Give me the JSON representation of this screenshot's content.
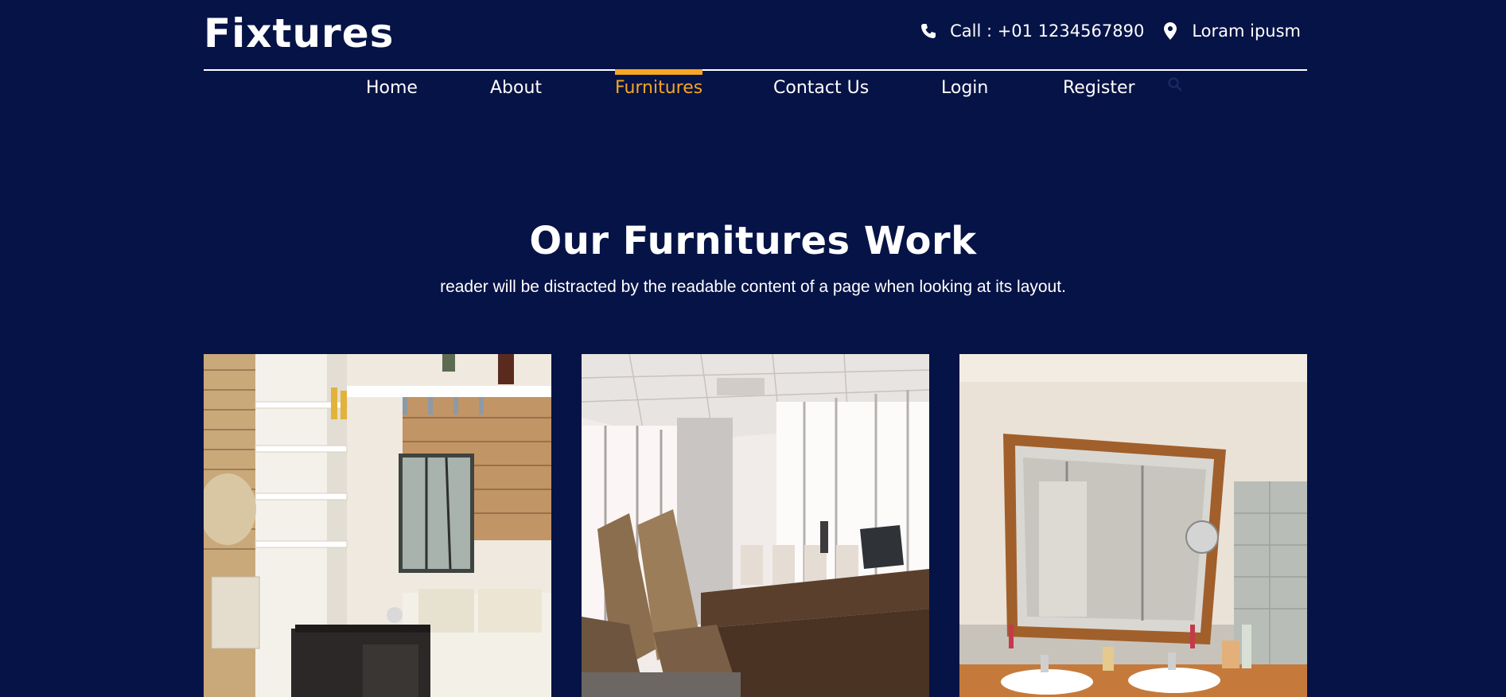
{
  "header": {
    "logo": "Fixtures",
    "phone_label": "Call : +01 1234567890",
    "location_label": "Loram ipusm"
  },
  "nav": {
    "items": [
      {
        "label": "Home",
        "active": false
      },
      {
        "label": "About",
        "active": false
      },
      {
        "label": "Furnitures",
        "active": true
      },
      {
        "label": "Contact Us",
        "active": false
      },
      {
        "label": "Login",
        "active": false
      },
      {
        "label": "Register",
        "active": false
      }
    ],
    "search_icon": "search-icon"
  },
  "section": {
    "title": "Our Furnitures Work",
    "subtitle": "reader will be distracted by the readable content of a page when looking at its layout."
  },
  "gallery": {
    "items": [
      {
        "subject": "living room with shelves and sofa"
      },
      {
        "subject": "conference room with chairs and table"
      },
      {
        "subject": "bathroom with mirror and double sink"
      }
    ]
  },
  "colors": {
    "background": "#061346",
    "accent": "#f5a623",
    "text": "#ffffff"
  }
}
